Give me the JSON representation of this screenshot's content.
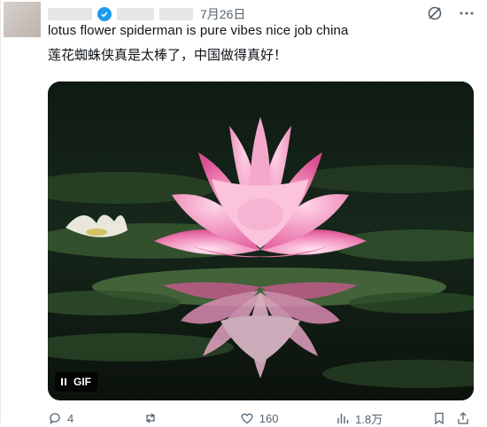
{
  "post": {
    "date": "7月26日",
    "text_line1": "lotus flower spiderman is pure vibes nice job china",
    "text_line2": "莲花蜘蛛侠真是太棒了，中国做得真好！",
    "media_badge": "GIF"
  },
  "icons": {
    "verified": "verified-badge-icon",
    "grok": "grok-icon",
    "more": "more-icon",
    "reply": "reply-icon",
    "repost": "repost-icon",
    "like": "like-icon",
    "views": "views-icon",
    "bookmark": "bookmark-icon",
    "share": "share-icon"
  },
  "actions": {
    "replies": "4",
    "reposts": "",
    "likes": "160",
    "views": "1.8万"
  },
  "colors": {
    "accent": "#1d9bf0",
    "muted": "#536471",
    "lotus": "#f08ab8"
  }
}
